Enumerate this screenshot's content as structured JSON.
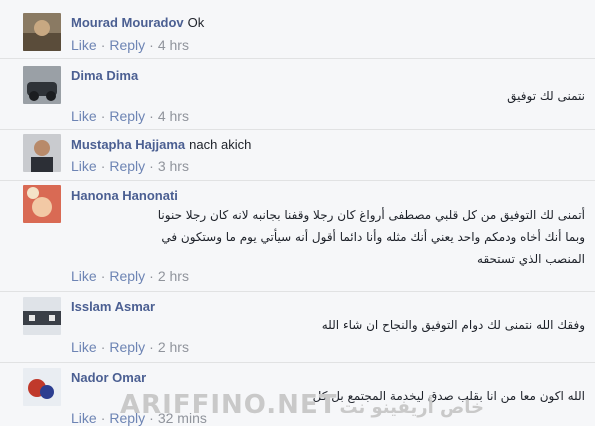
{
  "comments": [
    {
      "author": "Mourad Mouradov",
      "text": "Ok",
      "like": "Like",
      "reply": "Reply",
      "time": "4 hrs"
    },
    {
      "author": "Dima Dima",
      "text": "نتمنى لك توفيق",
      "like": "Like",
      "reply": "Reply",
      "time": "4 hrs"
    },
    {
      "author": "Mustapha Hajjama",
      "text": "nach akich",
      "like": "Like",
      "reply": "Reply",
      "time": "3 hrs"
    },
    {
      "author": "Hanona Hanonati",
      "lines": [
        "أتمنى لك التوفيق من كل قلبي مصطفى أرواغ كان رجلا وقفنا بجانبه لانه كان رجلا حنونا",
        "وبما أنك أخاه ودمكم واحد يعني أنك مثله وأنا دائما أقول أنه سيأتي يوم ما وستكون في",
        "المنصب الذي تستحقه"
      ],
      "like": "Like",
      "reply": "Reply",
      "time": "2 hrs"
    },
    {
      "author": "Isslam Asmar",
      "text": "وفقك الله نتمنى لك دوام التوفيق والنجاح ان شاء الله",
      "like": "Like",
      "reply": "Reply",
      "time": "2 hrs"
    },
    {
      "author": "Nador Omar",
      "text": "الله اكون معا من انا بقلب صدق ليخدمة المجتمع بل كل",
      "like": "Like",
      "reply": "Reply",
      "time": "32 mins"
    }
  ],
  "colors": {
    "author": "#4b5f92",
    "link": "#6d84b4",
    "meta": "#90949c",
    "background": "#f6f7f9"
  },
  "watermark": {
    "latin": "ARIFFINO.NET",
    "arabic": "خاص أريفينو نت"
  }
}
